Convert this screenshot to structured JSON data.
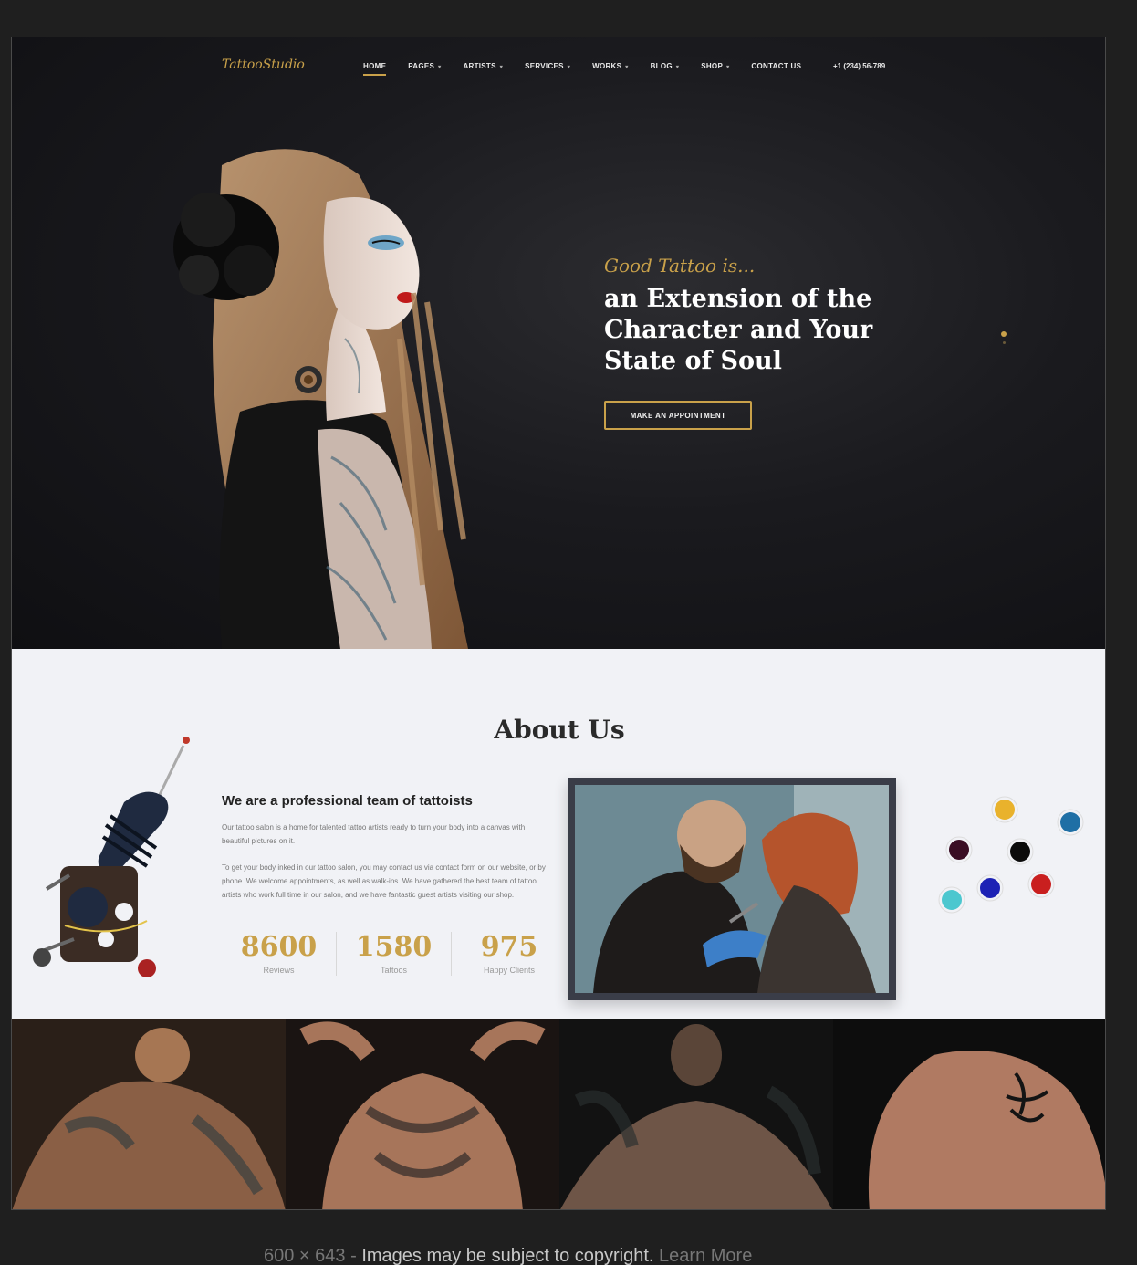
{
  "site": {
    "logo": "TattooStudio",
    "nav": [
      {
        "label": "HOME",
        "caret": false,
        "active": true
      },
      {
        "label": "PAGES",
        "caret": true
      },
      {
        "label": "ARTISTS",
        "caret": true
      },
      {
        "label": "SERVICES",
        "caret": true
      },
      {
        "label": "WORKS",
        "caret": true
      },
      {
        "label": "BLOG",
        "caret": true
      },
      {
        "label": "SHOP",
        "caret": true
      },
      {
        "label": "CONTACT US",
        "caret": false
      }
    ],
    "phone": "+1 (234) 56-789"
  },
  "hero": {
    "kicker": "Good Tattoo is...",
    "headline_lines": [
      "an Extension of the",
      "Character and Your",
      "State of Soul"
    ],
    "cta": "MAKE AN APPOINTMENT"
  },
  "about": {
    "title": "About Us",
    "subtitle": "We are a professional team of tattoists",
    "p1": "Our tattoo salon is a home for talented tattoo artists ready to turn your body into a canvas with beautiful pictures on it.",
    "p2": "To get your body inked in our tattoo salon, you may contact us via contact form on our website, or by phone. We welcome appointments, as well as walk-ins. We have gathered the best team of tattoo artists who work full time in our salon, and we have fantastic guest artists visiting our shop.",
    "stats": [
      {
        "value": "8600",
        "label": "Reviews"
      },
      {
        "value": "1580",
        "label": "Tattoos"
      },
      {
        "value": "975",
        "label": "Happy Clients"
      }
    ]
  },
  "caption": {
    "dimensions": "600 × 643",
    "separator": "-",
    "notice": "Images may be subject to copyright.",
    "link": "Learn More"
  },
  "colors": {
    "accent": "#c9a14a",
    "page_bg": "#1f1f1f",
    "hero_bg": "#1a1a1e",
    "about_bg": "#f1f2f6"
  }
}
